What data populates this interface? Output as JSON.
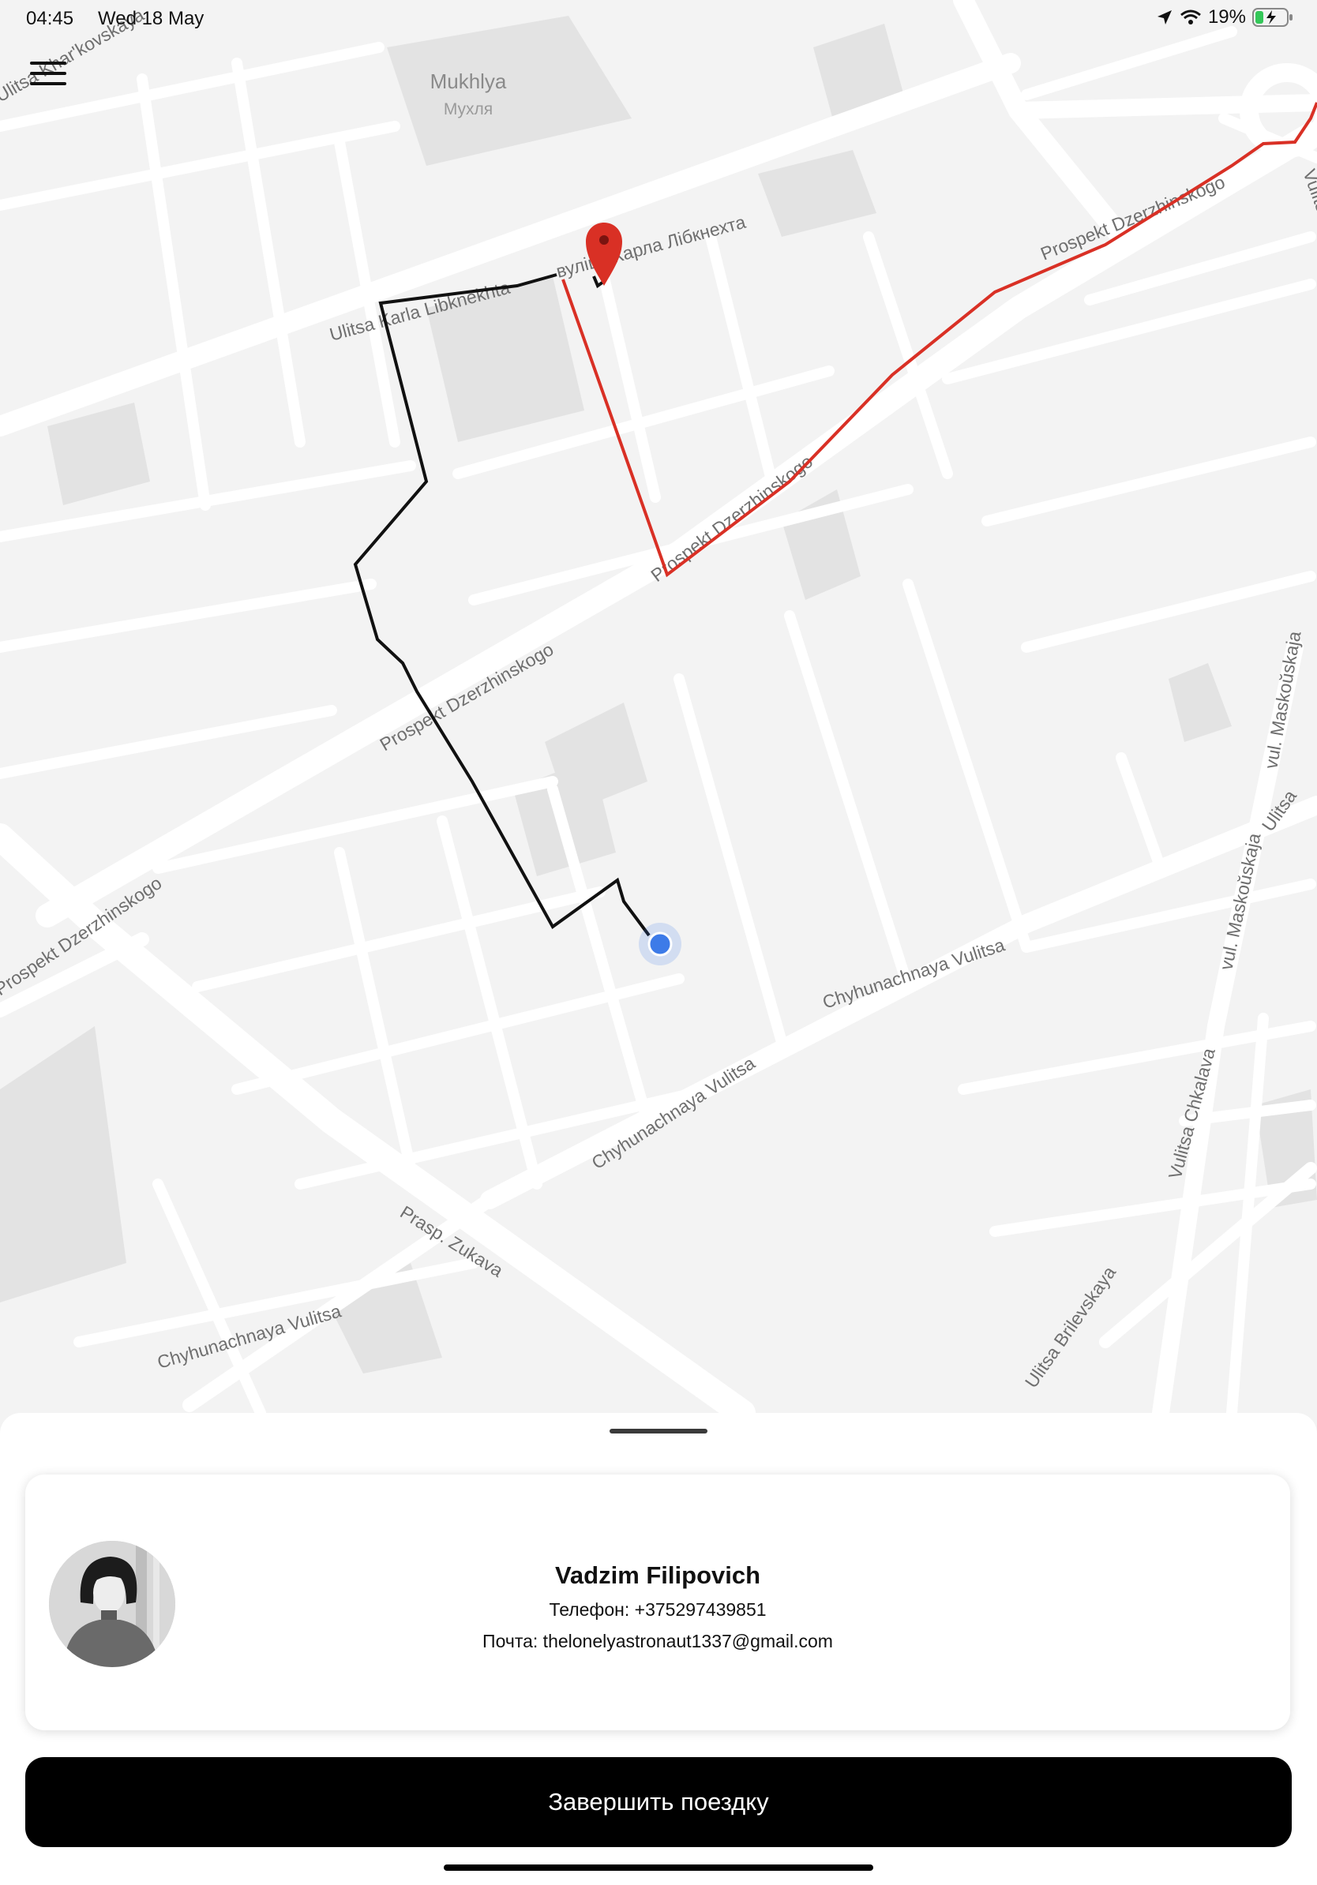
{
  "status_bar": {
    "time": "04:45",
    "date": "Wed 18 May",
    "battery": "19%",
    "icons": [
      "location-arrow-icon",
      "wifi-icon",
      "battery-charging-icon"
    ]
  },
  "map": {
    "poi": {
      "name": "Mukhlya",
      "name_local": "Мухля"
    },
    "street_labels": [
      "Ulitsa Khar'kovskaya",
      "Ulitsa Karla Libknekhta",
      "вуліца Карла Лібкнехта",
      "Prospekt Dzerzhinskogo",
      "Prospekt Dzerzhinskogo",
      "Prospekt Dzerzhinskogo",
      "Prospekt Dzerzhinskogo",
      "Chyhunachnaya Vulitsa",
      "Chyhunachnaya Vulitsa",
      "Chyhunachnaya Vulitsa",
      "Prasp. Zukava",
      "vul. Maskoŭskaja",
      "vul. Maskoŭskaja",
      "Ulitsa",
      "Vulitsa Chkalava",
      "Ulitsa Brilevskaya",
      "Vulits"
    ],
    "route_colors": {
      "driver": "#111111",
      "trip": "#d93025"
    },
    "marker_color": "#d93025",
    "user_dot_color": "#3d7be8"
  },
  "driver": {
    "name": "Vadzim Filipovich",
    "phone": "Телефон: +375297439851",
    "email": "Почта: thelonelyastronaut1337@gmail.com"
  },
  "actions": {
    "finish_label": "Завершить поездку"
  }
}
